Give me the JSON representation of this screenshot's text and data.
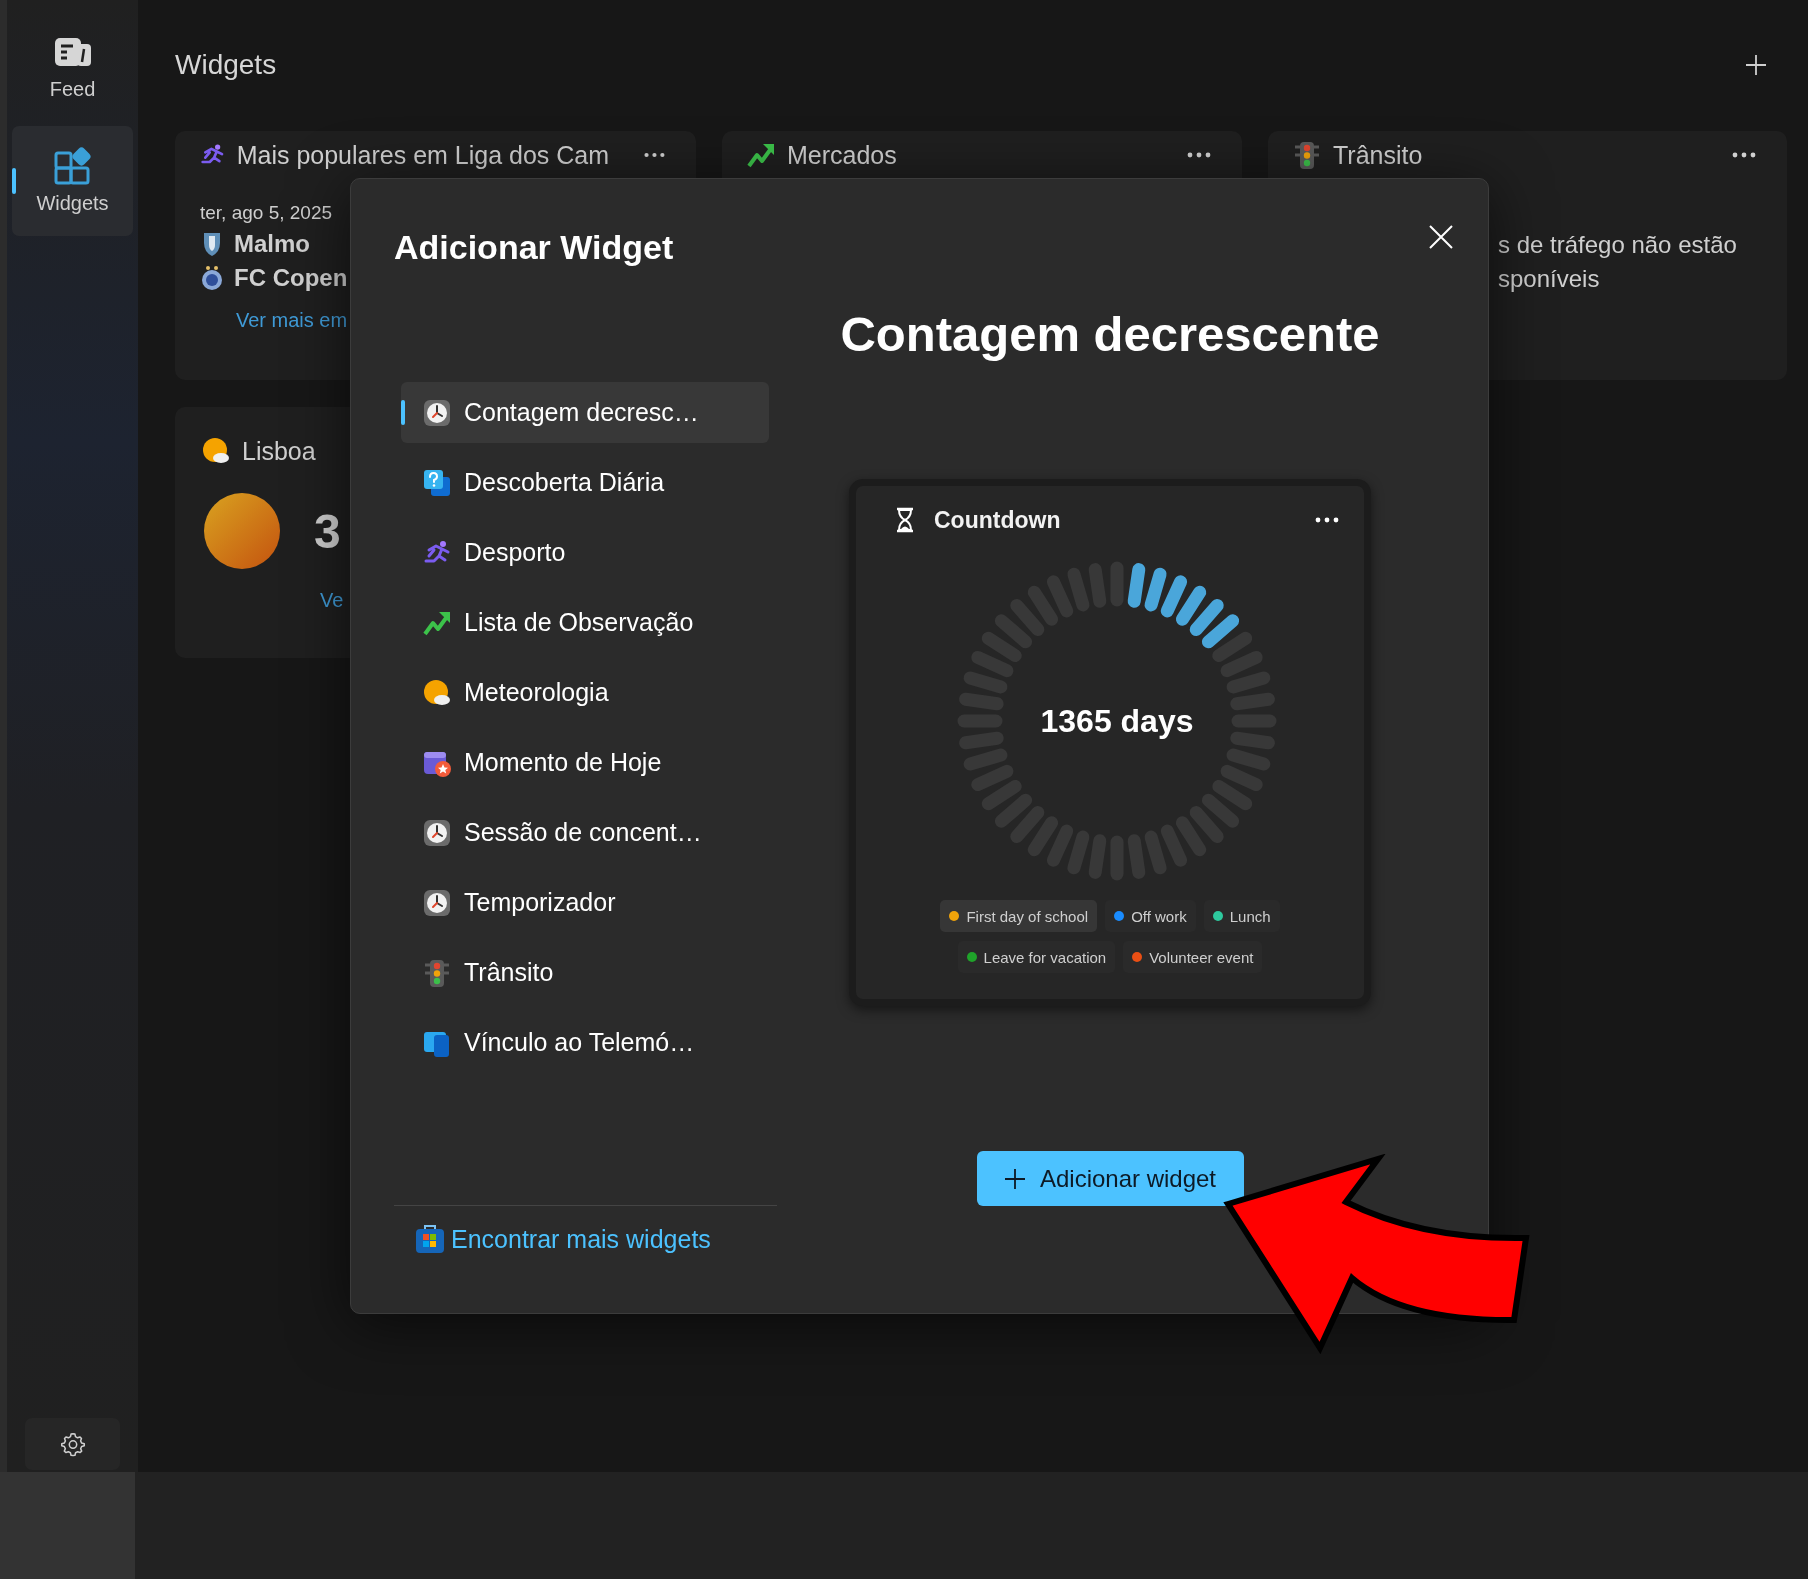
{
  "sidebar": {
    "items": [
      {
        "label": "Feed",
        "kind": "feed",
        "selected": false
      },
      {
        "label": "Widgets",
        "kind": "widgets",
        "selected": true
      }
    ]
  },
  "header": {
    "title": "Widgets"
  },
  "cards": [
    {
      "kind": "sports",
      "title": "Mais populares em Liga dos Cam",
      "date": "ter, ago 5, 2025",
      "teams": [
        {
          "name": "Malmo",
          "kind": "shield"
        },
        {
          "name": "FC Copen",
          "kind": "ball"
        }
      ],
      "link": "Ver mais em"
    },
    {
      "kind": "markets",
      "title": "Mercados"
    },
    {
      "kind": "traffic",
      "title": "Trânsito",
      "message": "s de tráfego não estão\nsponíveis"
    },
    {
      "kind": "weather",
      "title": "Lisboa",
      "temperature": "3",
      "link": "Ve"
    }
  ],
  "dialog": {
    "title": "Adicionar Widget",
    "widgets": [
      {
        "label": "Contagem decresc…",
        "kind": "clock",
        "selected": true
      },
      {
        "label": "Descoberta Diária",
        "kind": "question",
        "selected": false
      },
      {
        "label": "Desporto",
        "kind": "runner",
        "selected": false
      },
      {
        "label": "Lista de Observação",
        "kind": "trend",
        "selected": false
      },
      {
        "label": "Meteorologia",
        "kind": "sun",
        "selected": false
      },
      {
        "label": "Momento de Hoje",
        "kind": "calendar",
        "selected": false
      },
      {
        "label": "Sessão de concent…",
        "kind": "clock",
        "selected": false
      },
      {
        "label": "Temporizador",
        "kind": "clock",
        "selected": false
      },
      {
        "label": "Trânsito",
        "kind": "traffic",
        "selected": false
      },
      {
        "label": "Vínculo ao Telemó…",
        "kind": "phone",
        "selected": false
      }
    ],
    "find_more": "Encontrar mais widgets",
    "preview": {
      "heading": "Contagem decrescente",
      "widget": {
        "title": "Countdown",
        "value": "1365 days",
        "events": [
          {
            "label": "First day of school",
            "color": "#f0a30a",
            "selected": true
          },
          {
            "label": "Off work",
            "color": "#1a8cff",
            "selected": false
          },
          {
            "label": "Lunch",
            "color": "#2ec99e",
            "selected": false
          },
          {
            "label": "Leave for vacation",
            "color": "#1fa32a",
            "selected": false
          },
          {
            "label": "Volunteer event",
            "color": "#ea4f14",
            "selected": false
          }
        ]
      }
    },
    "add_button": "Adicionar widget"
  },
  "annotation": {
    "kind": "arrow"
  }
}
